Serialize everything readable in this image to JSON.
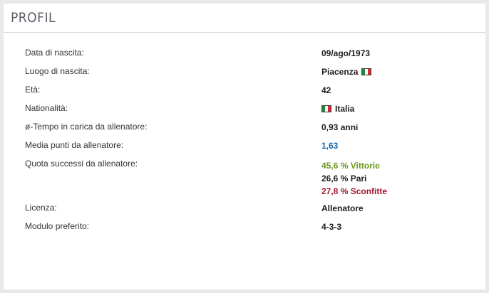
{
  "header": {
    "title": "PROFIL"
  },
  "colors": {
    "win": "#6a9a1f",
    "draw": "#1d1d1d",
    "loss": "#a3172c",
    "link": "#1a6aa8",
    "flag_it": [
      "#1f8a3a",
      "#ffffff",
      "#cf2b37"
    ]
  },
  "profile": {
    "birth_date": {
      "label": "Data di nascita:",
      "value": "09/ago/1973"
    },
    "birth_place": {
      "label": "Luogo di nascita:",
      "value": "Piacenza",
      "flag_icon": "italy-flag-icon"
    },
    "age": {
      "label": "Età:",
      "value": "42"
    },
    "nationality": {
      "label": "Nationalità:",
      "value": "Italia",
      "flag_icon": "italy-flag-icon"
    },
    "avg_tenure": {
      "label": "ø-Tempo in carica da allenatore:",
      "value": "0,93 anni"
    },
    "avg_points": {
      "label": "Media punti da allenatore:",
      "value": "1,63"
    },
    "success_rate": {
      "label": "Quota successi da allenatore:",
      "wins": "45,6 % Vittorie",
      "draws": "26,6 % Pari",
      "losses": "27,8 % Sconfitte"
    },
    "license": {
      "label": "Licenza:",
      "value": "Allenatore"
    },
    "formation": {
      "label": "Modulo preferito:",
      "value": "4-3-3"
    }
  }
}
